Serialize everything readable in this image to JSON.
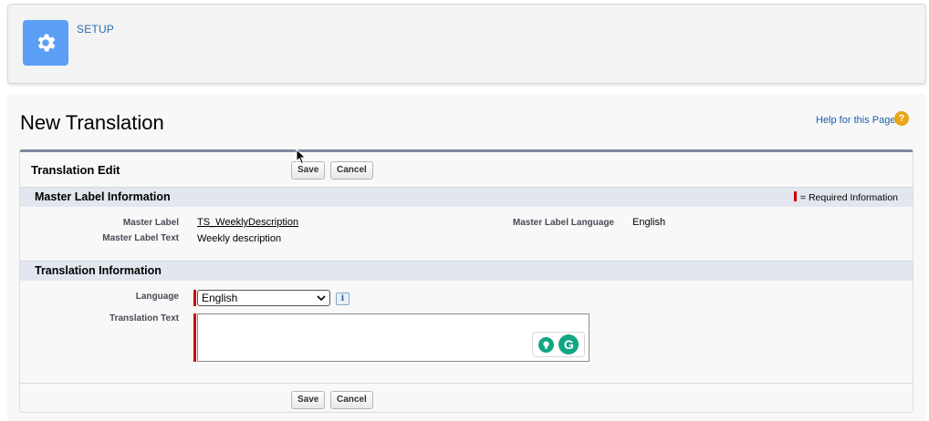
{
  "header": {
    "setup_label": "SETUP",
    "icon": "gear-icon",
    "accent": "#5b9ff5"
  },
  "page": {
    "title": "New Translation",
    "help_link": "Help for this Page",
    "help_icon": "?"
  },
  "panel": {
    "title": "Translation Edit",
    "save_label": "Save",
    "cancel_label": "Cancel"
  },
  "master": {
    "section_title": "Master Label Information",
    "required_info": "= Required Information",
    "master_label_caption": "Master Label",
    "master_label_value": "TS_WeeklyDescription",
    "master_label_text_caption": "Master Label Text",
    "master_label_text_value": "Weekly description",
    "master_language_caption": "Master Label Language",
    "master_language_value": "English"
  },
  "translation": {
    "section_title": "Translation Information",
    "language_caption": "Language",
    "language_value": "English",
    "info_glyph": "i",
    "translation_text_caption": "Translation Text",
    "translation_text_value": "",
    "grammarly_glyph": "G"
  },
  "colors": {
    "required": "#cc0000",
    "link": "#1a5ea8",
    "grammarly": "#11a683"
  }
}
